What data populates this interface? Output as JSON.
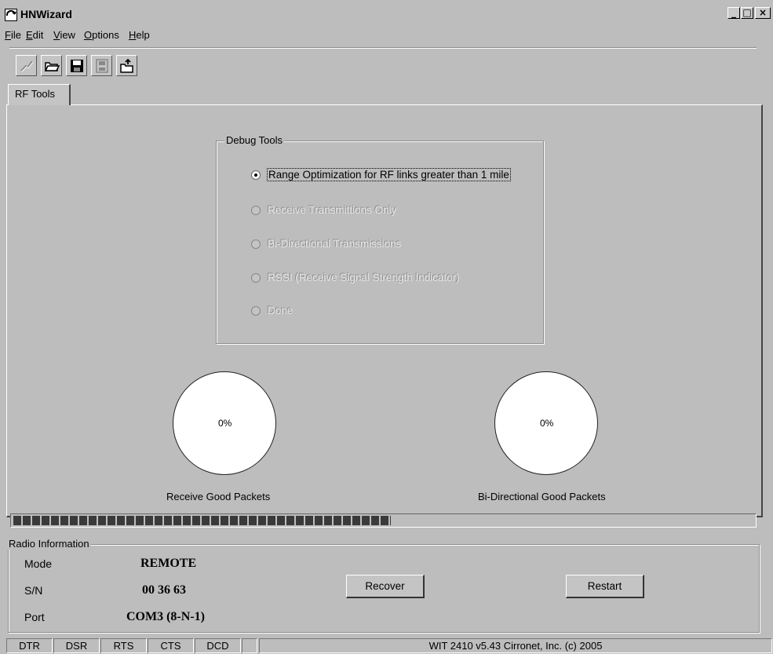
{
  "window": {
    "title": "HNWizard",
    "controls": {
      "minimize": "_",
      "maximize": "□",
      "close": "×"
    }
  },
  "menu": [
    {
      "label": "File",
      "accel": "F",
      "rest": "ile"
    },
    {
      "label": "Edit",
      "accel": "E",
      "rest": "dit"
    },
    {
      "label": "View",
      "accel": "V",
      "rest": "iew"
    },
    {
      "label": "Options",
      "accel": "O",
      "rest": "ptions"
    },
    {
      "label": "Help",
      "accel": "H",
      "rest": "elp"
    }
  ],
  "toolbar": [
    {
      "icon": "connect-icon",
      "enabled": false
    },
    {
      "icon": "open-folder-icon",
      "enabled": true
    },
    {
      "icon": "save-icon",
      "enabled": true
    },
    {
      "icon": "save-as-icon",
      "enabled": false
    },
    {
      "icon": "upload-icon",
      "enabled": true
    }
  ],
  "tabs": [
    {
      "label": "RF Tools",
      "selected": true
    }
  ],
  "debug_tools": {
    "title": "Debug Tools",
    "options": [
      {
        "label": "Range Optimization for RF links greater than 1 mile",
        "selected": true,
        "enabled": true
      },
      {
        "label": "Receive Transmittions Only",
        "selected": false,
        "enabled": false
      },
      {
        "label": "Bi-Directional Transmissions",
        "selected": false,
        "enabled": false
      },
      {
        "label": "RSSI (Receive Signal Strength Indicator)",
        "selected": false,
        "enabled": false
      },
      {
        "label": "Done",
        "selected": false,
        "enabled": false
      }
    ]
  },
  "gauges": {
    "receive": {
      "value": "0%",
      "label": "Receive Good Packets"
    },
    "bidirectional": {
      "value": "0%",
      "label": "Bi-Directional Good Packets"
    }
  },
  "progress": {
    "fraction": 0.51,
    "color": "#3a3a3a"
  },
  "radio_info": {
    "title": "Radio Information",
    "mode_label": "Mode",
    "mode_value": "REMOTE",
    "sn_label": "S/N",
    "sn_value": "00 36 63",
    "port_label": "Port",
    "port_value": "COM3 (8-N-1)",
    "recover_label": "Recover",
    "restart_label": "Restart"
  },
  "status": {
    "dtr": "DTR",
    "dsr": "DSR",
    "rts": "RTS",
    "cts": "CTS",
    "dcd": "DCD",
    "info": "WIT 2410 v5.43 Cirronet, Inc. (c) 2005"
  }
}
